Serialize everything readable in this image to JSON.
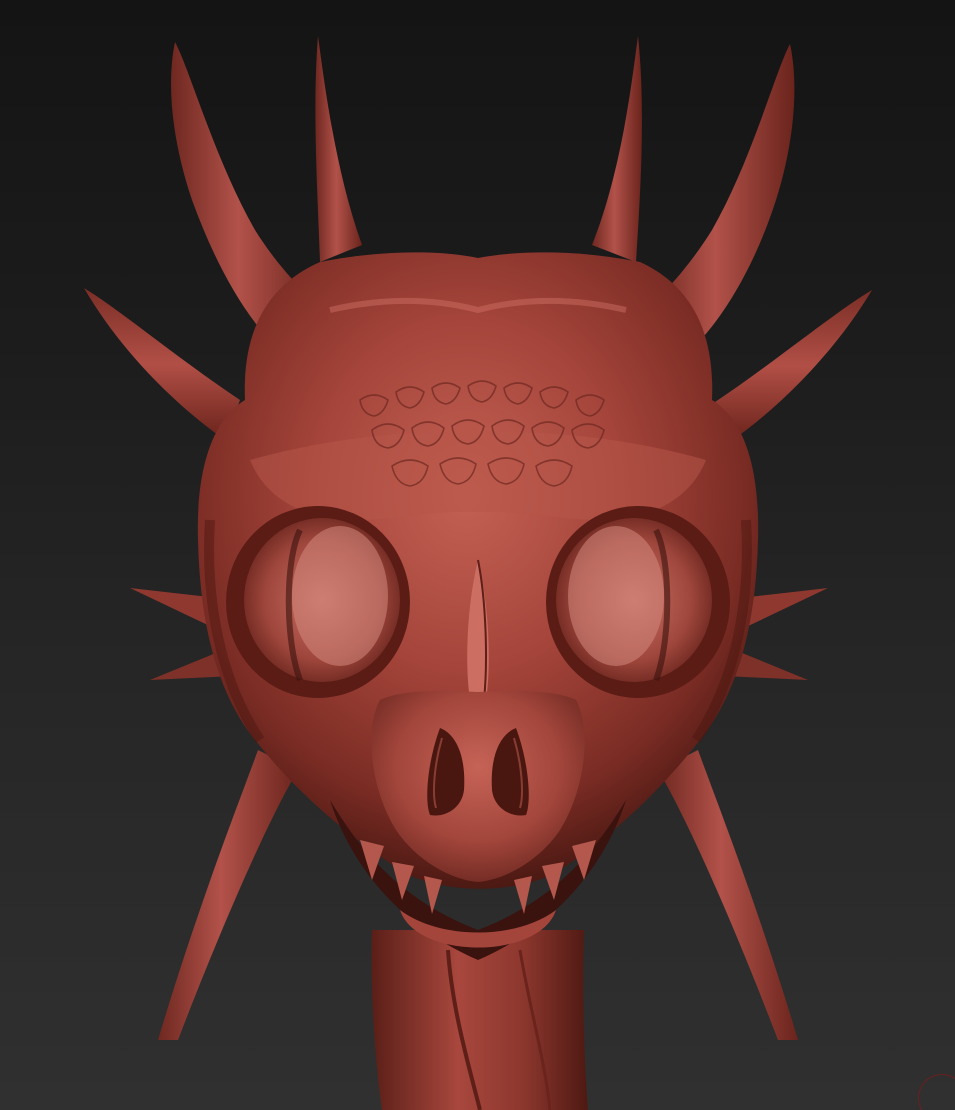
{
  "scene": {
    "subject_icon": "dragon-skull-sculpt",
    "background_top": "#141414",
    "background_bottom": "#303030",
    "clay_base": "#9c3b30",
    "clay_light": "#c9685c",
    "clay_dark": "#5e1f18",
    "clay_shadow": "#3a120e",
    "corner_mark_color": "#6b1f1f"
  }
}
